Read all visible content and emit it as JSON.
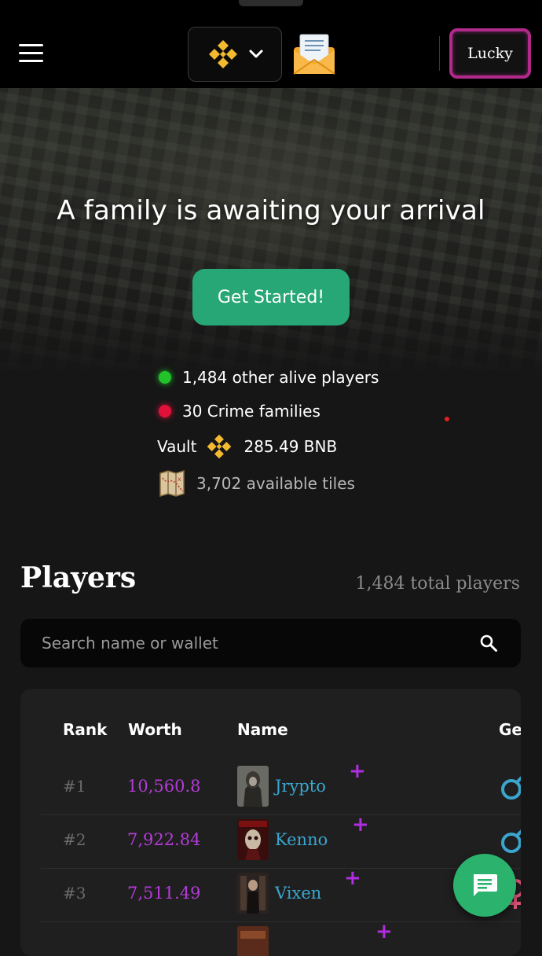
{
  "header": {
    "chain_icon": "bnb-icon",
    "mail_icon": "envelope-icon",
    "user_label": "Lucky"
  },
  "hero": {
    "tagline": "A family is awaiting your arrival",
    "cta_label": "Get Started!"
  },
  "stats": {
    "alive_players": "1,484 other alive players",
    "crime_families": "30 Crime families",
    "vault_label": "Vault",
    "vault_value": "285.49 BNB",
    "tiles": "3,702 available tiles"
  },
  "players": {
    "title": "Players",
    "total": "1,484 total players",
    "search_placeholder": "Search name or wallet",
    "columns": [
      "Rank",
      "Worth",
      "Name",
      "Ge"
    ],
    "rows": [
      {
        "rank": "#1",
        "worth": "10,560.8",
        "name": "Jrypto",
        "gender": "male"
      },
      {
        "rank": "#2",
        "worth": "7,922.84",
        "name": "Kenno",
        "gender": "male"
      },
      {
        "rank": "#3",
        "worth": "7,511.49",
        "name": "Vixen",
        "gender": "female"
      },
      {
        "rank": "",
        "worth": "",
        "name": "",
        "gender": ""
      }
    ]
  },
  "colors": {
    "accent_green": "#27a776",
    "worth_purple": "#b43bd9",
    "name_blue": "#3aa6cf",
    "user_border": "#b02a8a",
    "bnb_gold": "#f3ba2f"
  }
}
